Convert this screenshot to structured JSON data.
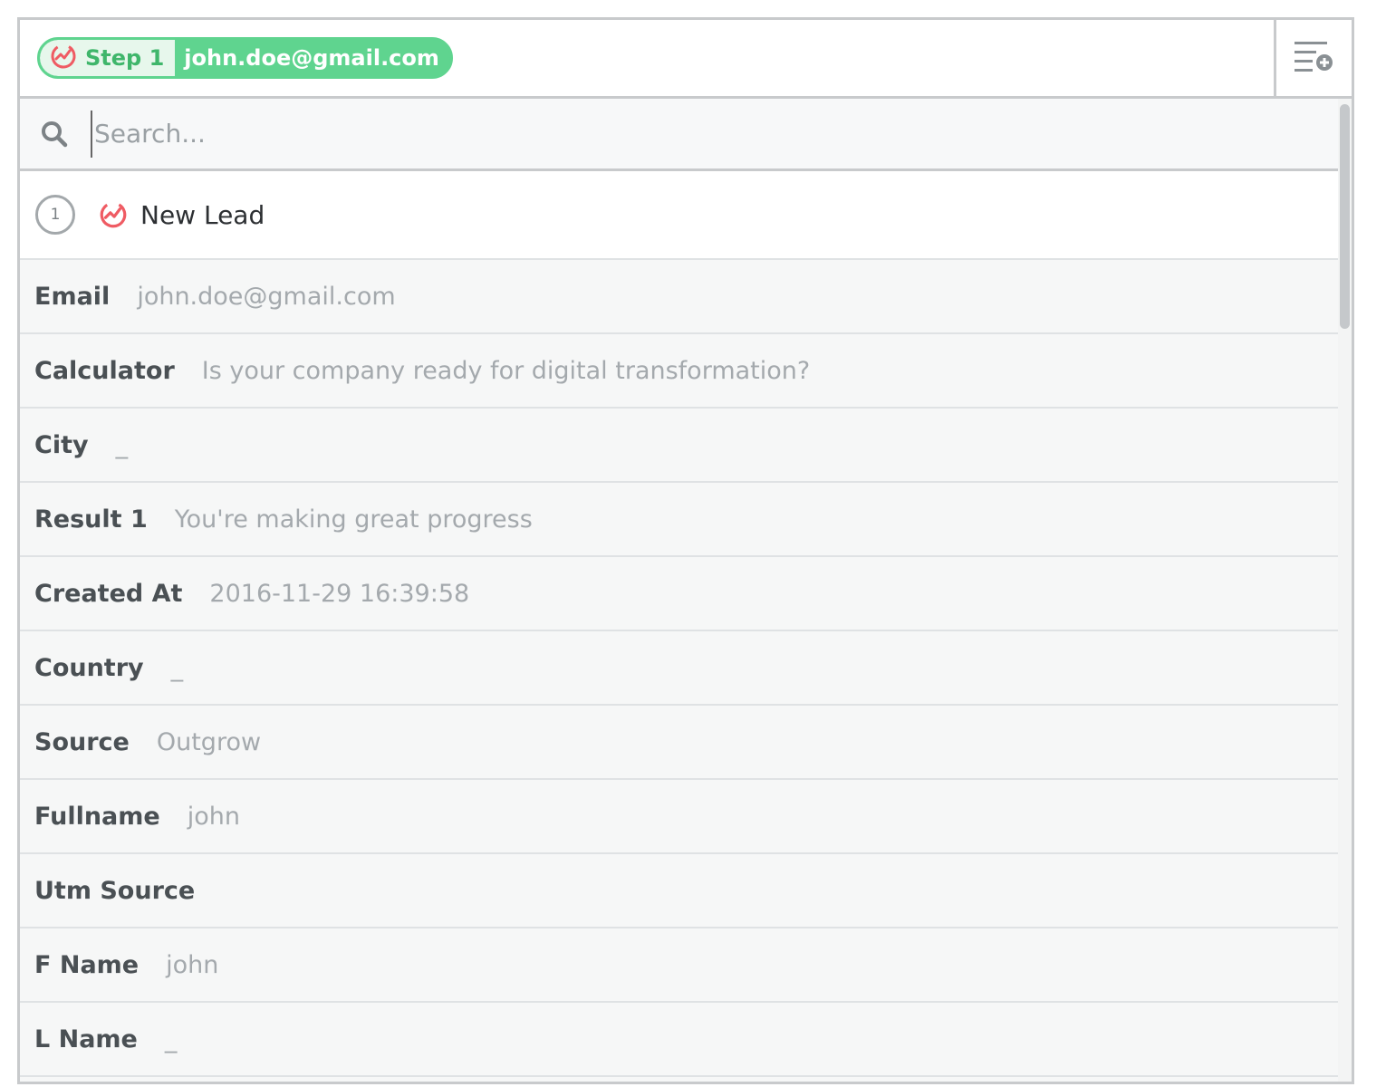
{
  "header": {
    "step_label": "Step 1",
    "step_email": "john.doe@gmail.com",
    "add_field_icon": "list-add-icon",
    "app_icon": "outgrow-icon"
  },
  "search": {
    "placeholder": "Search...",
    "value": "",
    "icon": "search-icon"
  },
  "lead": {
    "step_number": "1",
    "title": "New Lead",
    "icon": "outgrow-icon"
  },
  "fields": [
    {
      "label": "Email",
      "value": "john.doe@gmail.com"
    },
    {
      "label": "Calculator",
      "value": "Is your company ready for digital transformation?"
    },
    {
      "label": "City",
      "value": "_"
    },
    {
      "label": "Result 1",
      "value": "You're making great progress"
    },
    {
      "label": "Created At",
      "value": "2016-11-29 16:39:58"
    },
    {
      "label": "Country",
      "value": "_"
    },
    {
      "label": "Source",
      "value": "Outgrow"
    },
    {
      "label": "Fullname",
      "value": "john"
    },
    {
      "label": "Utm Source",
      "value": ""
    },
    {
      "label": "F Name",
      "value": "john"
    },
    {
      "label": "L Name",
      "value": "_"
    }
  ],
  "colors": {
    "accent_green": "#5fd48f",
    "brand_red": "#ef5b63",
    "border": "#c8cacc"
  }
}
